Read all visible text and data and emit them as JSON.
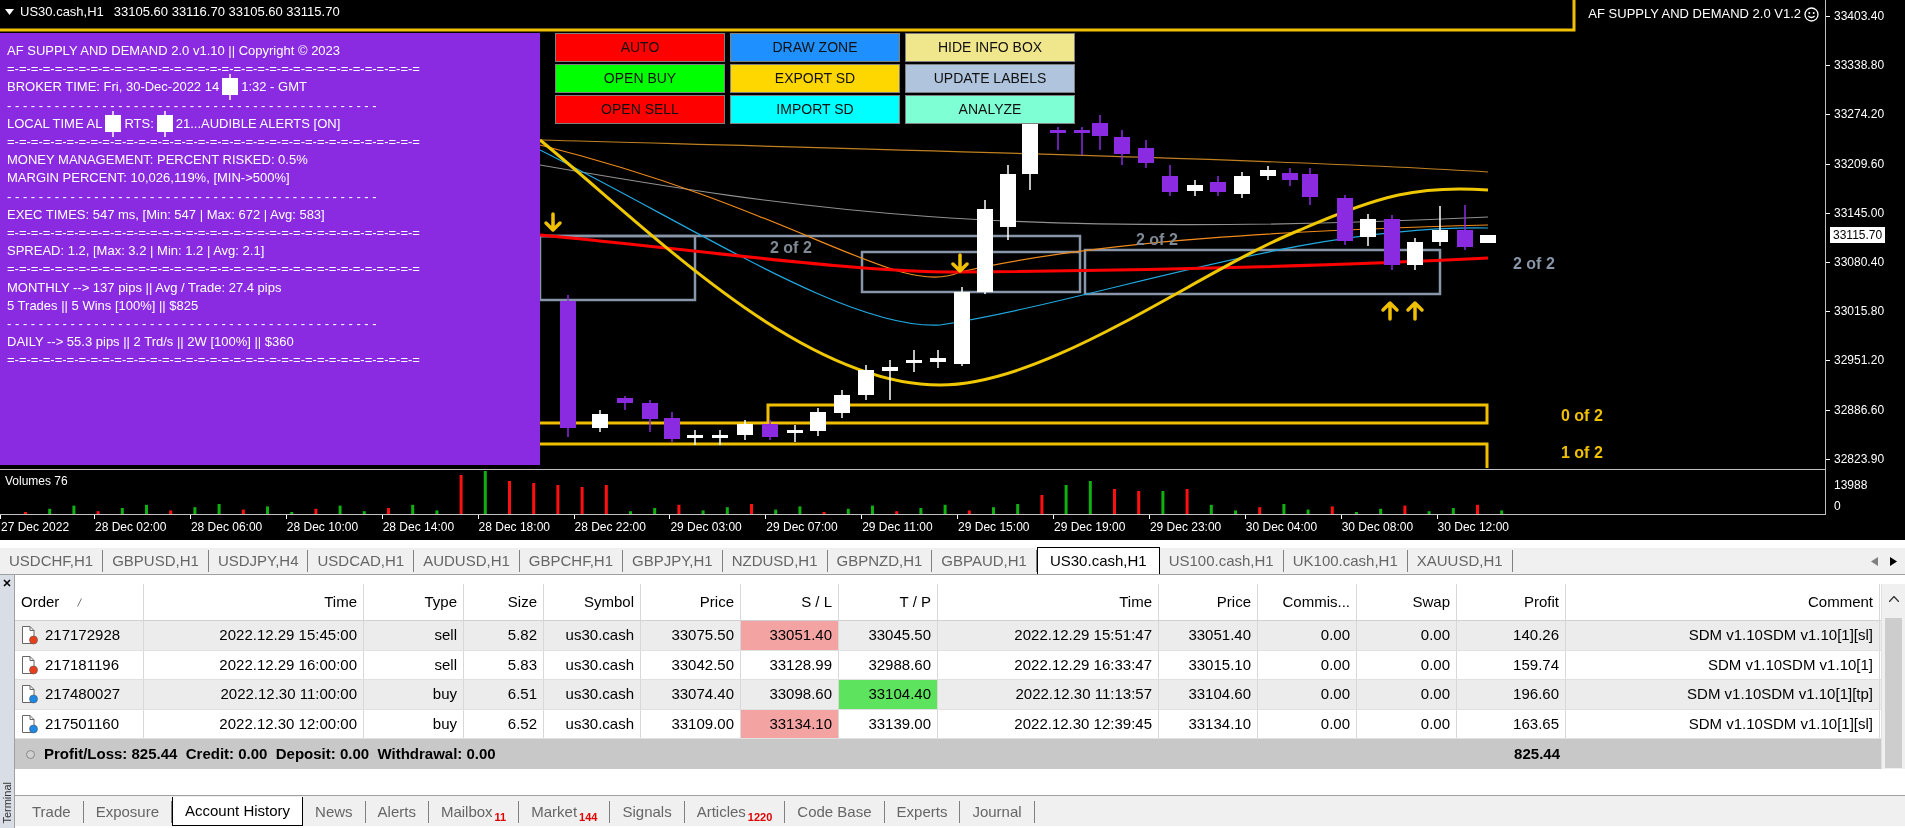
{
  "chart": {
    "symbol": "US30.cash,H1",
    "ohlc": "33105.60 33116.70 33105.60 33115.70",
    "indicator_title": "AF SUPPLY AND DEMAND 2.0 V1.2",
    "current_price": "33115.70",
    "price_axis": [
      "33403.40",
      "33338.80",
      "33274.20",
      "33209.60",
      "33145.00",
      "33080.40",
      "33015.80",
      "32951.20",
      "32886.60",
      "32823.90"
    ],
    "zone_labels": [
      {
        "text": "2 of 2",
        "color": "#808a96"
      },
      {
        "text": "2 of 2",
        "color": "#808a96"
      },
      {
        "text": "2 of 2",
        "color": "#8796a8"
      },
      {
        "text": "0 of 2",
        "color": "#f0c000"
      },
      {
        "text": "1 of 2",
        "color": "#f0c000"
      }
    ],
    "info_box": {
      "lines": [
        [
          "AF SUPPLY AND DEMAND 2.0 v1.10 || Copyright © 2023"
        ],
        [
          "=-=-=-=-=-=-=-=-=-=-=-=-=-=-=-=-=-=-=-=-=-=-=-=-=-=-=-=-=-=-=-=-=-=-="
        ],
        [
          "BROKER TIME: Fri, 30-Dec-2022 14",
          "1:32 - GMT"
        ],
        [
          "- - - - - - - - - - - - - - - - - - - - - - - - - - - - - - - - - - - - - - - - - - - - - - -"
        ],
        [
          "LOCAL TIME AL",
          "RTS:",
          "21...AUDIBLE ALERTS [ON]"
        ],
        [
          "=-=-=-=-=-=-=-=-=-=-=-=-=-=-=-=-=-=-=-=-=-=-=-=-=-=-=-=-=-=-=-=-=-=-="
        ],
        [
          "MONEY MANAGEMENT: PERCENT RISKED: 0.5%"
        ],
        [
          "MARGIN PERCENT: 10,026,119%, [MIN->500%]"
        ],
        [
          "- - - - - - - - - - - - - - - - - - - - - - - - - - - - - - - - - - - - - - - - - - - - - - -"
        ],
        [
          "EXEC TIMES: 547 ms, [Min: 547 | Max: 672 | Avg: 583]"
        ],
        [
          "=-=-=-=-=-=-=-=-=-=-=-=-=-=-=-=-=-=-=-=-=-=-=-=-=-=-=-=-=-=-=-=-=-=-="
        ],
        [
          "SPREAD: 1.2, [Max: 3.2 | Min: 1.2 | Avg: 2.1]"
        ],
        [
          "=-=-=-=-=-=-=-=-=-=-=-=-=-=-=-=-=-=-=-=-=-=-=-=-=-=-=-=-=-=-=-=-=-=-="
        ],
        [
          "MONTHLY --> 137 pips || Avg / Trade: 27.4 pips"
        ],
        [
          "5 Trades || 5 Wins [100%] || $825"
        ],
        [
          "- - - - - - - - - - - - - - - - - - - - - - - - - - - - - - - - - - - - - - - - - - - - - - -"
        ],
        [
          "DAILY --> 55.3 pips || 2 Trd/s || 2W [100%] || $360"
        ],
        [
          "=-=-=-=-=-=-=-=-=-=-=-=-=-=-=-=-=-=-=-=-=-=-=-=-=-=-=-=-=-=-=-=-=-=-="
        ]
      ]
    },
    "buttons": [
      {
        "label": "AUTO",
        "color": "#ff0000"
      },
      {
        "label": "DRAW ZONE",
        "color": "#1e90ff"
      },
      {
        "label": "HIDE INFO BOX",
        "color": "#f0e68c"
      },
      {
        "label": "OPEN BUY",
        "color": "#00ff00"
      },
      {
        "label": "EXPORT SD",
        "color": "#ffd700"
      },
      {
        "label": "UPDATE LABELS",
        "color": "#b0c4de"
      },
      {
        "label": "OPEN SELL",
        "color": "#ff0000"
      },
      {
        "label": "IMPORT SD",
        "color": "#00ffff"
      },
      {
        "label": "ANALYZE",
        "color": "#7fffd4"
      }
    ]
  },
  "volume": {
    "title": "Volumes 76",
    "axis": [
      "13988",
      "0"
    ]
  },
  "time_axis": [
    "27 Dec 2022",
    "28 Dec 02:00",
    "28 Dec 06:00",
    "28 Dec 10:00",
    "28 Dec 14:00",
    "28 Dec 18:00",
    "28 Dec 22:00",
    "29 Dec 03:00",
    "29 Dec 07:00",
    "29 Dec 11:00",
    "29 Dec 15:00",
    "29 Dec 19:00",
    "29 Dec 23:00",
    "30 Dec 04:00",
    "30 Dec 08:00",
    "30 Dec 12:00"
  ],
  "symbol_tabs": [
    {
      "label": "USDCHF,H1",
      "selected": false
    },
    {
      "label": "GBPUSD,H1",
      "selected": false
    },
    {
      "label": "USDJPY,H4",
      "selected": false
    },
    {
      "label": "USDCAD,H1",
      "selected": false
    },
    {
      "label": "AUDUSD,H1",
      "selected": false
    },
    {
      "label": "GBPCHF,H1",
      "selected": false
    },
    {
      "label": "GBPJPY,H1",
      "selected": false
    },
    {
      "label": "NZDUSD,H1",
      "selected": false
    },
    {
      "label": "GBPNZD,H1",
      "selected": false
    },
    {
      "label": "GBPAUD,H1",
      "selected": false
    },
    {
      "label": "US30.cash,H1",
      "selected": true
    },
    {
      "label": "US100.cash,H1",
      "selected": false
    },
    {
      "label": "UK100.cash,H1",
      "selected": false
    },
    {
      "label": "XAUUSD,H1",
      "selected": false
    }
  ],
  "table": {
    "columns": [
      "Order",
      "Time",
      "Type",
      "Size",
      "Symbol",
      "Price",
      "S / L",
      "T / P",
      "Time",
      "Price",
      "Commis...",
      "Swap",
      "Profit",
      "Comment"
    ],
    "rows": [
      {
        "kind": "sell",
        "sl_highlight": true,
        "tp_highlight": false,
        "cells": [
          "217172928",
          "2022.12.29 15:45:00",
          "sell",
          "5.82",
          "us30.cash",
          "33075.50",
          "33051.40",
          "33045.50",
          "2022.12.29 15:51:47",
          "33051.40",
          "0.00",
          "0.00",
          "140.26",
          "SDM v1.10SDM v1.10[1][sl]"
        ]
      },
      {
        "kind": "sell",
        "sl_highlight": false,
        "tp_highlight": false,
        "cells": [
          "217181196",
          "2022.12.29 16:00:00",
          "sell",
          "5.83",
          "us30.cash",
          "33042.50",
          "33128.99",
          "32988.60",
          "2022.12.29 16:33:47",
          "33015.10",
          "0.00",
          "0.00",
          "159.74",
          "SDM v1.10SDM v1.10[1]"
        ]
      },
      {
        "kind": "buy",
        "sl_highlight": false,
        "tp_highlight": true,
        "cells": [
          "217480027",
          "2022.12.30 11:00:00",
          "buy",
          "6.51",
          "us30.cash",
          "33074.40",
          "33098.60",
          "33104.40",
          "2022.12.30 11:13:57",
          "33104.60",
          "0.00",
          "0.00",
          "196.60",
          "SDM v1.10SDM v1.10[1][tp]"
        ]
      },
      {
        "kind": "buy",
        "sl_highlight": true,
        "tp_highlight": false,
        "cells": [
          "217501160",
          "2022.12.30 12:00:00",
          "buy",
          "6.52",
          "us30.cash",
          "33109.00",
          "33134.10",
          "33139.00",
          "2022.12.30 12:39:45",
          "33134.10",
          "0.00",
          "0.00",
          "163.65",
          "SDM v1.10SDM v1.10[1][sl]"
        ]
      }
    ],
    "total": {
      "summary": "Profit/Loss: 825.44  Credit: 0.00  Deposit: 0.00  Withdrawal: 0.00",
      "profit": "825.44"
    }
  },
  "terminal": {
    "label": "Terminal"
  },
  "bottom_tabs": [
    {
      "label": "Trade",
      "selected": false
    },
    {
      "label": "Exposure",
      "selected": false
    },
    {
      "label": "Account History",
      "selected": true
    },
    {
      "label": "News",
      "selected": false
    },
    {
      "label": "Alerts",
      "selected": false
    },
    {
      "label": "Mailbox",
      "badge": "11",
      "selected": false
    },
    {
      "label": "Market",
      "badge": "144",
      "selected": false
    },
    {
      "label": "Signals",
      "selected": false
    },
    {
      "label": "Articles",
      "badge": "1220",
      "selected": false
    },
    {
      "label": "Code Base",
      "selected": false
    },
    {
      "label": "Experts",
      "selected": false
    },
    {
      "label": "Journal",
      "selected": false
    }
  ]
}
